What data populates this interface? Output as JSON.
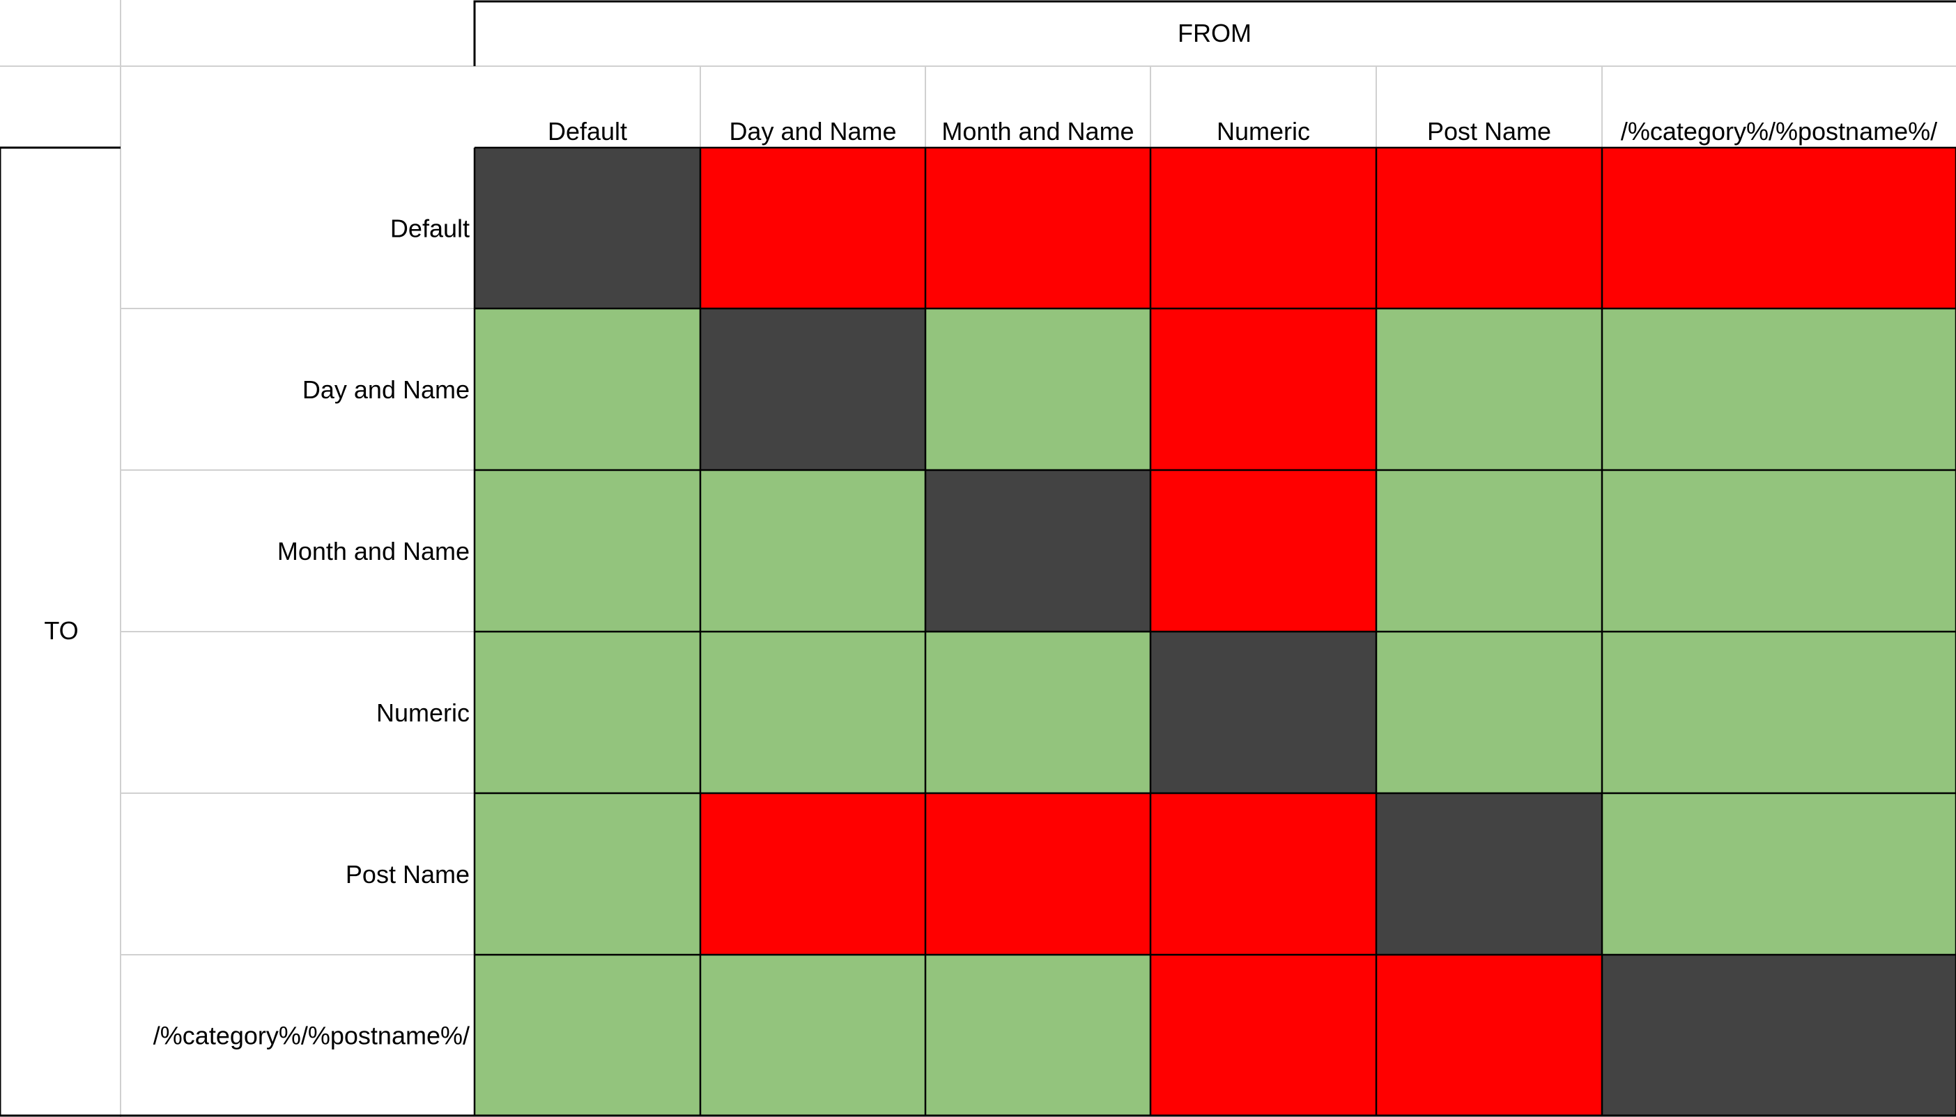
{
  "chart_data": {
    "type": "heatmap",
    "column_group_label": "FROM",
    "row_group_label": "TO",
    "columns": [
      "Default",
      "Day and Name",
      "Month and Name",
      "Numeric",
      "Post Name",
      "/%category%/%postname%/"
    ],
    "rows": [
      "Default",
      "Day and Name",
      "Month and Name",
      "Numeric",
      "Post Name",
      "/%category%/%postname%/"
    ],
    "cells": [
      [
        "dark",
        "red",
        "red",
        "red",
        "red",
        "red"
      ],
      [
        "green",
        "dark",
        "green",
        "red",
        "green",
        "green"
      ],
      [
        "green",
        "green",
        "dark",
        "red",
        "green",
        "green"
      ],
      [
        "green",
        "green",
        "green",
        "dark",
        "green",
        "green"
      ],
      [
        "green",
        "red",
        "red",
        "red",
        "dark",
        "green"
      ],
      [
        "green",
        "green",
        "green",
        "red",
        "red",
        "dark"
      ]
    ],
    "colors": {
      "dark": "#434343",
      "red": "#ff0000",
      "green": "#93c47d"
    }
  }
}
